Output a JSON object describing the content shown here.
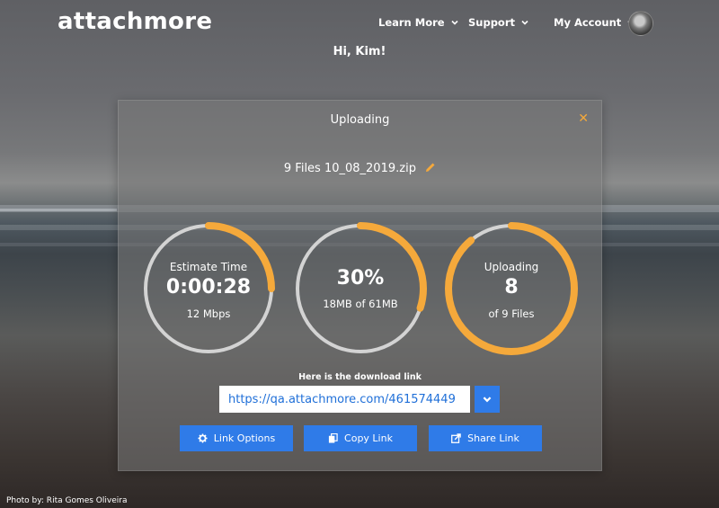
{
  "brand": {
    "name": "attachmore"
  },
  "nav": {
    "items": [
      {
        "label": "Learn More",
        "icon": "chevron-down-icon"
      },
      {
        "label": "Support",
        "icon": "chevron-down-icon"
      },
      {
        "label": "My Account",
        "icon": "chevron-down-icon"
      }
    ]
  },
  "greeting": "Hi, Kim!",
  "modal": {
    "title": "Uploading",
    "close_icon": "close-icon",
    "filename": "9 Files 10_08_2019.zip",
    "edit_icon": "pencil-icon"
  },
  "stats": {
    "estimate": {
      "title": "Estimate Time",
      "value": "0:00:28",
      "sub": "12 Mbps",
      "progress": 0.25
    },
    "percent": {
      "value": "30%",
      "sub": "18MB of 61MB",
      "progress": 0.3
    },
    "files": {
      "title": "Uploading",
      "value": "8",
      "sub": "of 9 Files",
      "progress": 0.889
    }
  },
  "download": {
    "caption": "Here is the download link",
    "url": "https://qa.attachmore.com/461574449",
    "dropdown_icon": "chevron-down-icon"
  },
  "actions": [
    {
      "label": "Link Options",
      "icon": "gear-icon"
    },
    {
      "label": "Copy Link",
      "icon": "copy-icon"
    },
    {
      "label": "Share Link",
      "icon": "share-icon"
    }
  ],
  "colors": {
    "accent": "#f5a93b",
    "primary": "#2f7be8",
    "track": "#d3d3d3"
  },
  "photo_credit": "Photo by: Rita Gomes Oliveira"
}
